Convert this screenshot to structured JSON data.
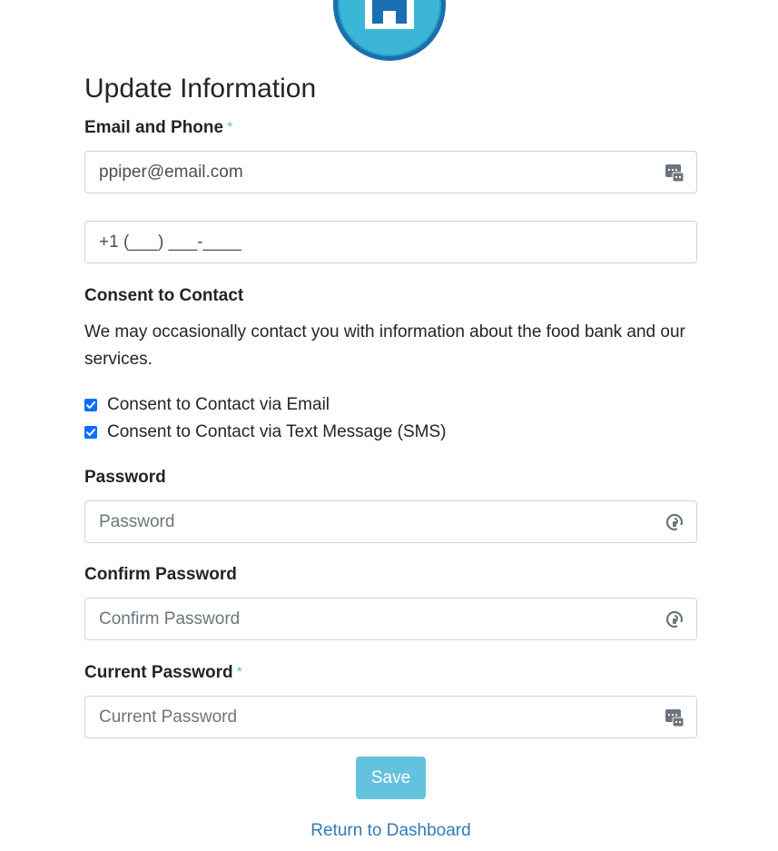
{
  "page": {
    "title": "Update Information"
  },
  "contact": {
    "label": "Email and Phone",
    "required_mark": "*",
    "email_value": "ppiper@email.com",
    "phone_value": "+1 (___) ___-____"
  },
  "consent": {
    "heading": "Consent to Contact",
    "description": "We may occasionally contact you with information about the food bank and our services.",
    "options": [
      {
        "label": "Consent to Contact via Email",
        "checked": true
      },
      {
        "label": "Consent to Contact via Text Message (SMS)",
        "checked": true
      }
    ]
  },
  "password": {
    "label": "Password",
    "placeholder": "Password"
  },
  "confirm_password": {
    "label": "Confirm Password",
    "placeholder": "Confirm Password"
  },
  "current_password": {
    "label": "Current Password",
    "required_mark": "*",
    "placeholder": "Current Password"
  },
  "actions": {
    "save_label": "Save",
    "return_label": "Return to Dashboard"
  },
  "icons": {
    "logo": "logo-icon",
    "autofill": "autofill-keypad-icon",
    "password_manager": "password-key-icon"
  },
  "colors": {
    "accent": "#5bc0de",
    "link": "#337ab7",
    "checkbox": "#0d6efd",
    "logo_blue": "#1a6fb0",
    "logo_teal": "#2ba3c8"
  }
}
